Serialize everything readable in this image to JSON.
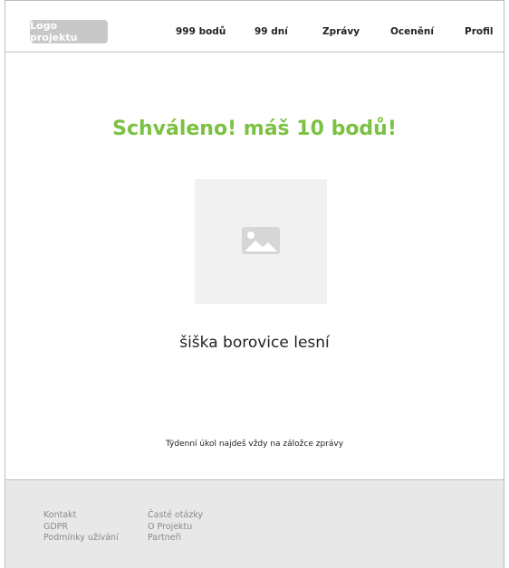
{
  "header": {
    "logo_label": "Logo projektu",
    "nav": {
      "points": "999 bodů",
      "days": "99 dní",
      "news": "Zprávy",
      "awards": "Ocenění",
      "profile": "Profil"
    }
  },
  "main": {
    "headline": "Schváleno! máš 10 bodů!",
    "image_icon": "image-icon",
    "item_name": "šiška borovice lesní",
    "hint": "Týdenní úkol najdeš vždy na záložce zprávy"
  },
  "footer": {
    "col1": [
      "Kontakt",
      "GDPR",
      "Podmínky užívání"
    ],
    "col2": [
      "Časté otázky",
      "O Projektu",
      "Partneři"
    ]
  },
  "colors": {
    "accent": "#7bc142",
    "logo_bg": "#c8c8c8",
    "footer_bg": "#e8e8e8",
    "placeholder_bg": "#f1f1f1"
  }
}
